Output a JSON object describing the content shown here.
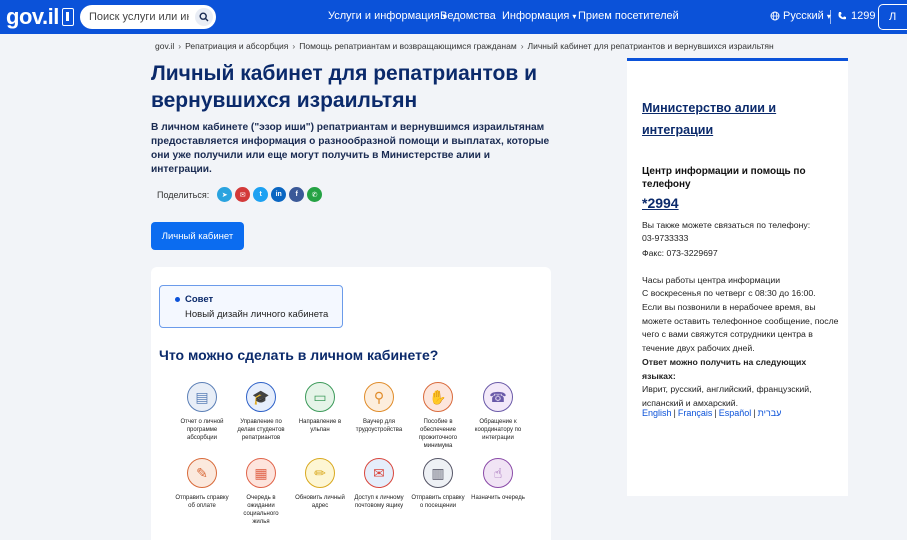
{
  "header": {
    "logo_text": "gov.il",
    "search_placeholder": "Поиск услуги или инф...",
    "nav": [
      {
        "label": "Услуги и информация",
        "has_caret": true
      },
      {
        "label": "Ведомства",
        "has_caret": false
      },
      {
        "label": "Информация",
        "has_caret": true
      },
      {
        "label": "Прием посетителей",
        "has_caret": false
      }
    ],
    "language": "Русский",
    "phone": "1299",
    "login_label": "Л"
  },
  "breadcrumb": [
    "gov.il",
    "Репатриация и абсорбция",
    "Помощь репатриантам и возвращающимся гражданам",
    "Личный кабинет для репатриантов и вернувшихся израильтян"
  ],
  "page": {
    "title": "Личный кабинет для репатриантов и вернувшихся израильтян",
    "intro": "В личном кабинете (\"эзор иши\") репатриантам и вернувшимся израильтянам предоставляется информация о разнообразной помощи и выплатах, которые они уже получили или еще могут получить в Министерстве алии и интеграции.",
    "share_label": "Поделиться:",
    "share_icons": [
      {
        "name": "telegram-icon",
        "color": "#2aa3df",
        "glyph": "➤"
      },
      {
        "name": "email-icon",
        "color": "#d33a3a",
        "glyph": "✉"
      },
      {
        "name": "twitter-icon",
        "color": "#1da1f2",
        "glyph": "t"
      },
      {
        "name": "linkedin-icon",
        "color": "#0a66c2",
        "glyph": "in"
      },
      {
        "name": "facebook-icon",
        "color": "#3b5998",
        "glyph": "f"
      },
      {
        "name": "whatsapp-icon",
        "color": "#25a244",
        "glyph": "✆"
      }
    ],
    "cabinet_button": "Личный кабинет"
  },
  "card": {
    "tip_title": "Совет",
    "tip_text": "Новый дизайн личного кабинета",
    "section_title": "Что можно сделать в личном кабинете?",
    "tiles": [
      {
        "label": "Отчет о личной программе абсорбции",
        "icon": "report-icon",
        "color": "#e8eef7",
        "accent": "#5b7fb6"
      },
      {
        "label": "Управление по делам студентов репатриантов",
        "icon": "graduation-icon",
        "color": "#e6eefc",
        "accent": "#2f62c8"
      },
      {
        "label": "Направление в ульпан",
        "icon": "board-icon",
        "color": "#e5f4e8",
        "accent": "#3c9a5a"
      },
      {
        "label": "Ваучер для трудоустройства",
        "icon": "search-person-icon",
        "color": "#fdeedd",
        "accent": "#e08c2a"
      },
      {
        "label": "Пособие в обеспечение прожиточного минимума",
        "icon": "money-hand-icon",
        "color": "#fde6dc",
        "accent": "#d96a3c"
      },
      {
        "label": "Обращение к координатору по интеграции",
        "icon": "phone-hand-icon",
        "color": "#f3e9f9",
        "accent": "#6a5aa8"
      },
      {
        "label": "Отправить справку об оплате",
        "icon": "document-pen-icon",
        "color": "#fbe9dd",
        "accent": "#d86a3a"
      },
      {
        "label": "Очередь в ожидании социального жилья",
        "icon": "calendar-icon",
        "color": "#fde4dd",
        "accent": "#e0644a"
      },
      {
        "label": "Обновить личный адрес",
        "icon": "pencil-icon",
        "color": "#fdf6d4",
        "accent": "#d9a91f"
      },
      {
        "label": "Доступ к личному почтовому ящику",
        "icon": "mail-icon",
        "color": "#e5eefb",
        "accent": "#d9463c"
      },
      {
        "label": "Отправить справку о посещении",
        "icon": "clipboard-icon",
        "color": "#eef1f5",
        "accent": "#556"
      },
      {
        "label": "Назначить очередь",
        "icon": "calendar-touch-icon",
        "color": "#f1e4f5",
        "accent": "#8a4aa8"
      }
    ]
  },
  "sidebar": {
    "ministry": "Министерство алии и интеграции",
    "info_center_heading": "Центр информации и помощь по телефону",
    "hotline": "*2994",
    "also_phone_label": "Вы также можете связаться по телефону:",
    "also_phone": "03-9733333",
    "fax": "Факс: 073-3229697",
    "hours_title": "Часы работы центра информации",
    "hours": "С воскресенья по четверг с 08:30 до 16:00.",
    "after_hours": "Если вы позвонили в нерабочее время, вы можете оставить телефонное сообщение, после чего с вами свяжутся сотрудники центра в течение двух рабочих дней.",
    "languages_heading": "Ответ можно получить на следующих языках:",
    "languages_text": "Иврит, русский, английский, французский, испанский и амхарский.",
    "lang_links": [
      "English",
      "Français",
      "Español",
      "עברית"
    ]
  }
}
